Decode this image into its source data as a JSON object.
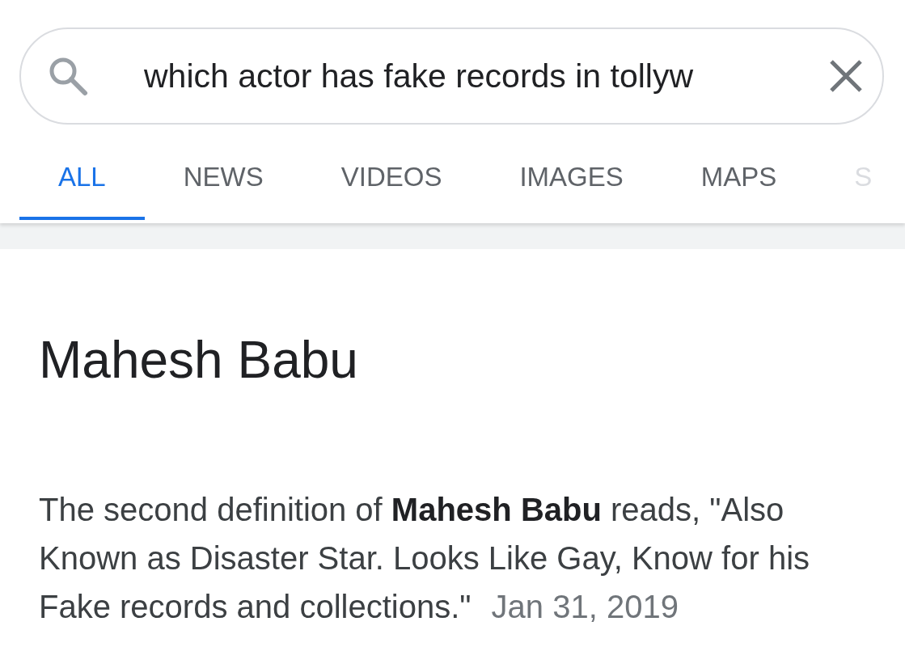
{
  "search": {
    "value": "which actor has fake records in tollyw"
  },
  "tabs": [
    {
      "label": "ALL",
      "selected": true
    },
    {
      "label": "NEWS",
      "selected": false
    },
    {
      "label": "VIDEOS",
      "selected": false
    },
    {
      "label": "IMAGES",
      "selected": false
    },
    {
      "label": "MAPS",
      "selected": false
    },
    {
      "label": "S",
      "selected": false
    }
  ],
  "result": {
    "title": "Mahesh Babu",
    "snippet": "The second definition of **Mahesh Babu** reads, \"Also Known as Disaster Star. Looks Like Gay, Know for his Fake records and collections.\"",
    "date": "Jan 31, 2019"
  }
}
